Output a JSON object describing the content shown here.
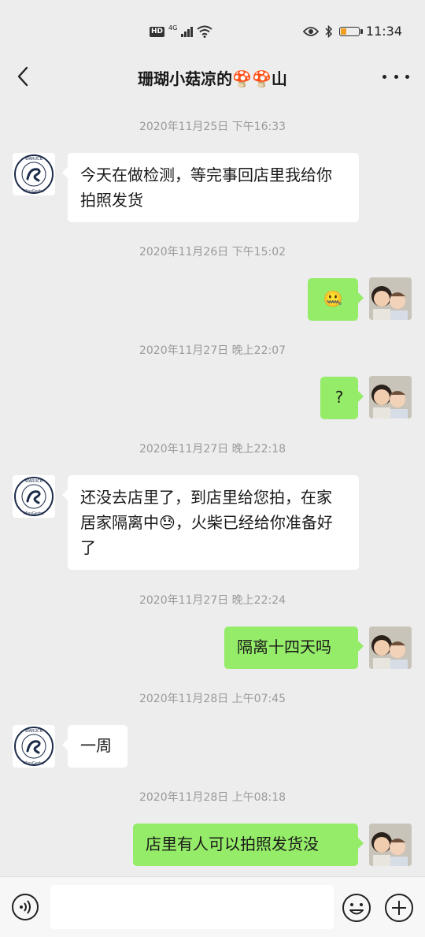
{
  "status_bar": {
    "hd": "HD",
    "network": "4G",
    "time": "11:34"
  },
  "header": {
    "title": "珊瑚小菇凉的🍄🍄山"
  },
  "contact_avatar_text": "WARUCB Miss Gerbe",
  "messages": [
    {
      "timestamp": "2020年11月25日 下午16:33",
      "sender": "contact",
      "text": "今天在做检测，等完事回店里我给你拍照发货"
    },
    {
      "timestamp": "2020年11月26日 下午15:02",
      "sender": "me",
      "text": "🤐"
    },
    {
      "timestamp": "2020年11月27日 晚上22:07",
      "sender": "me",
      "text": "?"
    },
    {
      "timestamp": "2020年11月27日 晚上22:18",
      "sender": "contact",
      "text": "还没去店里了，到店里给您拍，在家居家隔离中😓，火柴已经给你准备好了"
    },
    {
      "timestamp": "2020年11月27日 晚上22:24",
      "sender": "me",
      "text": "隔离十四天吗"
    },
    {
      "timestamp": "2020年11月28日 上午07:45",
      "sender": "contact",
      "text": "一周"
    },
    {
      "timestamp": "2020年11月28日 上午08:18",
      "sender": "me",
      "text": "店里有人可以拍照发货没"
    }
  ],
  "input_bar": {
    "value": "",
    "placeholder": ""
  },
  "colors": {
    "bubble_out": "#95ec69",
    "bubble_in": "#ffffff",
    "background": "#ededed"
  }
}
